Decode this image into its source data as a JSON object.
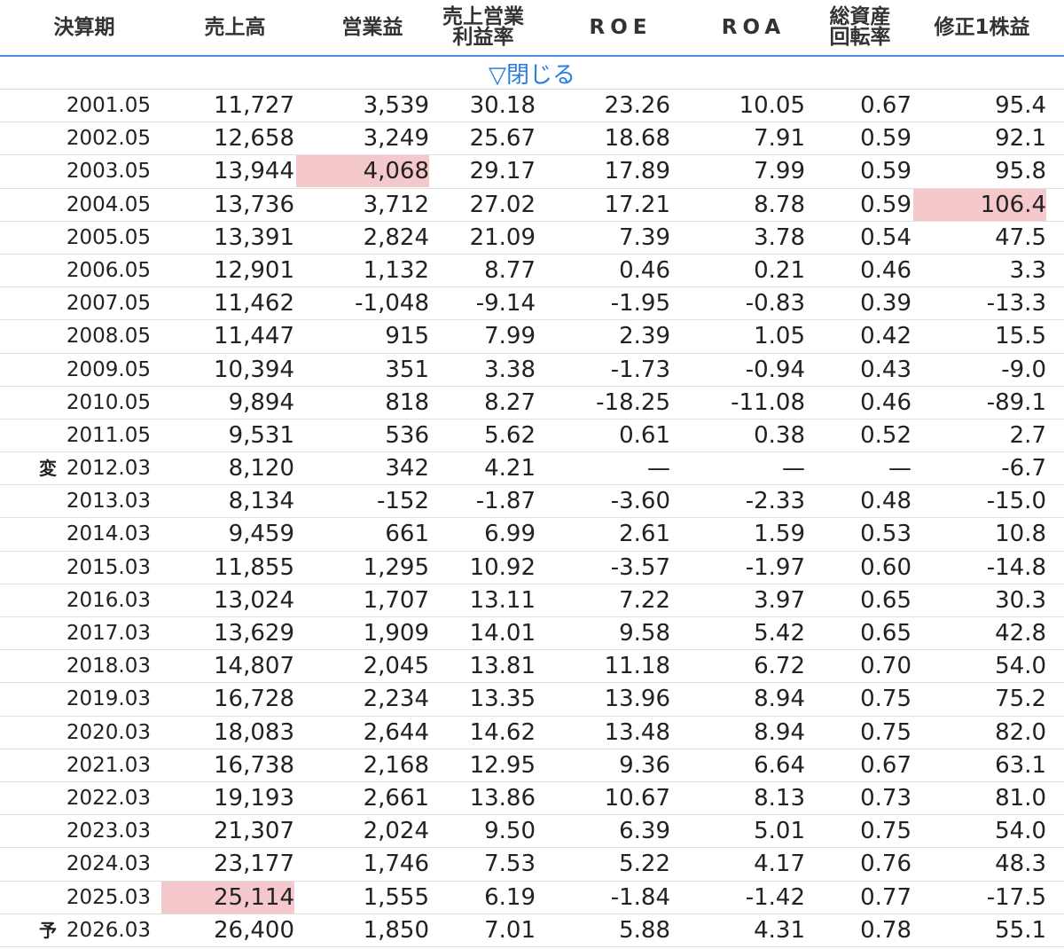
{
  "headers": {
    "period": "決算期",
    "sales": "売上高",
    "op_income": "営業益",
    "op_margin_line1": "売上営業",
    "op_margin_line2": "利益率",
    "roe": "ROE",
    "roa": "ROA",
    "turnover_line1": "総資産",
    "turnover_line2": "回転率",
    "eps": "修正1株益"
  },
  "toggle_label": "▽閉じる",
  "highlight_color": "#f5c9cc",
  "accent_color": "#4a90e2",
  "rows": [
    {
      "mark": "",
      "period": "2001.05",
      "sales": "11,727",
      "op": "3,539",
      "margin": "30.18",
      "roe": "23.26",
      "roa": "10.05",
      "turn": "0.67",
      "eps": "95.4",
      "hl": []
    },
    {
      "mark": "",
      "period": "2002.05",
      "sales": "12,658",
      "op": "3,249",
      "margin": "25.67",
      "roe": "18.68",
      "roa": "7.91",
      "turn": "0.59",
      "eps": "92.1",
      "hl": []
    },
    {
      "mark": "",
      "period": "2003.05",
      "sales": "13,944",
      "op": "4,068",
      "margin": "29.17",
      "roe": "17.89",
      "roa": "7.99",
      "turn": "0.59",
      "eps": "95.8",
      "hl": [
        "op"
      ]
    },
    {
      "mark": "",
      "period": "2004.05",
      "sales": "13,736",
      "op": "3,712",
      "margin": "27.02",
      "roe": "17.21",
      "roa": "8.78",
      "turn": "0.59",
      "eps": "106.4",
      "hl": [
        "eps"
      ]
    },
    {
      "mark": "",
      "period": "2005.05",
      "sales": "13,391",
      "op": "2,824",
      "margin": "21.09",
      "roe": "7.39",
      "roa": "3.78",
      "turn": "0.54",
      "eps": "47.5",
      "hl": []
    },
    {
      "mark": "",
      "period": "2006.05",
      "sales": "12,901",
      "op": "1,132",
      "margin": "8.77",
      "roe": "0.46",
      "roa": "0.21",
      "turn": "0.46",
      "eps": "3.3",
      "hl": []
    },
    {
      "mark": "",
      "period": "2007.05",
      "sales": "11,462",
      "op": "-1,048",
      "margin": "-9.14",
      "roe": "-1.95",
      "roa": "-0.83",
      "turn": "0.39",
      "eps": "-13.3",
      "hl": []
    },
    {
      "mark": "",
      "period": "2008.05",
      "sales": "11,447",
      "op": "915",
      "margin": "7.99",
      "roe": "2.39",
      "roa": "1.05",
      "turn": "0.42",
      "eps": "15.5",
      "hl": []
    },
    {
      "mark": "",
      "period": "2009.05",
      "sales": "10,394",
      "op": "351",
      "margin": "3.38",
      "roe": "-1.73",
      "roa": "-0.94",
      "turn": "0.43",
      "eps": "-9.0",
      "hl": []
    },
    {
      "mark": "",
      "period": "2010.05",
      "sales": "9,894",
      "op": "818",
      "margin": "8.27",
      "roe": "-18.25",
      "roa": "-11.08",
      "turn": "0.46",
      "eps": "-89.1",
      "hl": []
    },
    {
      "mark": "",
      "period": "2011.05",
      "sales": "9,531",
      "op": "536",
      "margin": "5.62",
      "roe": "0.61",
      "roa": "0.38",
      "turn": "0.52",
      "eps": "2.7",
      "hl": []
    },
    {
      "mark": "変",
      "period": "2012.03",
      "sales": "8,120",
      "op": "342",
      "margin": "4.21",
      "roe": "—",
      "roa": "—",
      "turn": "—",
      "eps": "-6.7",
      "hl": []
    },
    {
      "mark": "",
      "period": "2013.03",
      "sales": "8,134",
      "op": "-152",
      "margin": "-1.87",
      "roe": "-3.60",
      "roa": "-2.33",
      "turn": "0.48",
      "eps": "-15.0",
      "hl": []
    },
    {
      "mark": "",
      "period": "2014.03",
      "sales": "9,459",
      "op": "661",
      "margin": "6.99",
      "roe": "2.61",
      "roa": "1.59",
      "turn": "0.53",
      "eps": "10.8",
      "hl": []
    },
    {
      "mark": "",
      "period": "2015.03",
      "sales": "11,855",
      "op": "1,295",
      "margin": "10.92",
      "roe": "-3.57",
      "roa": "-1.97",
      "turn": "0.60",
      "eps": "-14.8",
      "hl": []
    },
    {
      "mark": "",
      "period": "2016.03",
      "sales": "13,024",
      "op": "1,707",
      "margin": "13.11",
      "roe": "7.22",
      "roa": "3.97",
      "turn": "0.65",
      "eps": "30.3",
      "hl": []
    },
    {
      "mark": "",
      "period": "2017.03",
      "sales": "13,629",
      "op": "1,909",
      "margin": "14.01",
      "roe": "9.58",
      "roa": "5.42",
      "turn": "0.65",
      "eps": "42.8",
      "hl": []
    },
    {
      "mark": "",
      "period": "2018.03",
      "sales": "14,807",
      "op": "2,045",
      "margin": "13.81",
      "roe": "11.18",
      "roa": "6.72",
      "turn": "0.70",
      "eps": "54.0",
      "hl": []
    },
    {
      "mark": "",
      "period": "2019.03",
      "sales": "16,728",
      "op": "2,234",
      "margin": "13.35",
      "roe": "13.96",
      "roa": "8.94",
      "turn": "0.75",
      "eps": "75.2",
      "hl": []
    },
    {
      "mark": "",
      "period": "2020.03",
      "sales": "18,083",
      "op": "2,644",
      "margin": "14.62",
      "roe": "13.48",
      "roa": "8.94",
      "turn": "0.75",
      "eps": "82.0",
      "hl": []
    },
    {
      "mark": "",
      "period": "2021.03",
      "sales": "16,738",
      "op": "2,168",
      "margin": "12.95",
      "roe": "9.36",
      "roa": "6.64",
      "turn": "0.67",
      "eps": "63.1",
      "hl": []
    },
    {
      "mark": "",
      "period": "2022.03",
      "sales": "19,193",
      "op": "2,661",
      "margin": "13.86",
      "roe": "10.67",
      "roa": "8.13",
      "turn": "0.73",
      "eps": "81.0",
      "hl": []
    },
    {
      "mark": "",
      "period": "2023.03",
      "sales": "21,307",
      "op": "2,024",
      "margin": "9.50",
      "roe": "6.39",
      "roa": "5.01",
      "turn": "0.75",
      "eps": "54.0",
      "hl": []
    },
    {
      "mark": "",
      "period": "2024.03",
      "sales": "23,177",
      "op": "1,746",
      "margin": "7.53",
      "roe": "5.22",
      "roa": "4.17",
      "turn": "0.76",
      "eps": "48.3",
      "hl": []
    },
    {
      "mark": "",
      "period": "2025.03",
      "sales": "25,114",
      "op": "1,555",
      "margin": "6.19",
      "roe": "-1.84",
      "roa": "-1.42",
      "turn": "0.77",
      "eps": "-17.5",
      "hl": [
        "sales"
      ]
    },
    {
      "mark": "予",
      "period": "2026.03",
      "sales": "26,400",
      "op": "1,850",
      "margin": "7.01",
      "roe": "5.88",
      "roa": "4.31",
      "turn": "0.78",
      "eps": "55.1",
      "hl": []
    }
  ]
}
